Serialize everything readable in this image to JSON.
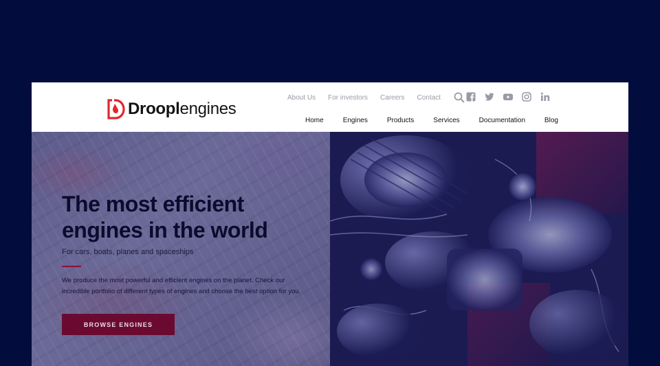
{
  "brand": {
    "name_bold": "Droopl",
    "name_light": "engines",
    "logo_icon": "droopl-logo-icon",
    "accent_color": "#e3262e"
  },
  "topnav": {
    "links": [
      "About Us",
      "For investors",
      "Careers",
      "Contact"
    ],
    "search_icon": "search-icon",
    "socials": [
      "facebook-icon",
      "twitter-icon",
      "youtube-icon",
      "instagram-icon",
      "linkedin-icon"
    ]
  },
  "mainnav": {
    "items": [
      "Home",
      "Engines",
      "Products",
      "Services",
      "Documentation",
      "Blog"
    ]
  },
  "hero": {
    "title": "The most efficient engines in the world",
    "subtitle": "For cars, boats, planes and spaceships",
    "body": "We produce the most powerful and efficient engines on the planet. Check our incredible portfolio of different types of engines and choose the best option for you.",
    "cta_label": "BROWSE ENGINES",
    "cta_color": "#6b0a30"
  },
  "colors": {
    "page_background": "#020c3d",
    "header_background": "#ffffff"
  }
}
